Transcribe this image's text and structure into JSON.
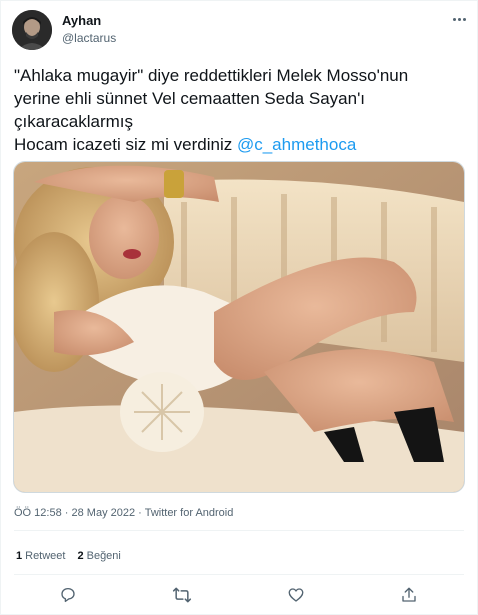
{
  "tweet": {
    "author": {
      "display_name": "Ayhan",
      "handle": "@lactarus"
    },
    "text": {
      "line1": "\"Ahlaka mugayir\" diye reddettikleri Melek Mosso'nun",
      "line2": "yerine ehli sünnet Vel cemaatten Seda Sayan'ı",
      "line3": "çıkaracaklarmış",
      "line4_prefix": "Hocam icazeti siz mi verdiniz ",
      "mention": "@c_ahmethoca"
    },
    "meta": {
      "time": "ÖÖ 12:58",
      "date": "28 May 2022",
      "source": "Twitter for Android",
      "separator": "·"
    },
    "stats": {
      "retweets": {
        "count": "1",
        "label": "Retweet"
      },
      "likes": {
        "count": "2",
        "label": "Beğeni"
      }
    }
  },
  "icons": [
    "more-icon",
    "reply-icon",
    "retweet-icon",
    "like-icon",
    "share-icon"
  ],
  "colors": {
    "text": "#0f1419",
    "secondary": "#536471",
    "link": "#1d9bf0",
    "border": "#eff3f4"
  }
}
